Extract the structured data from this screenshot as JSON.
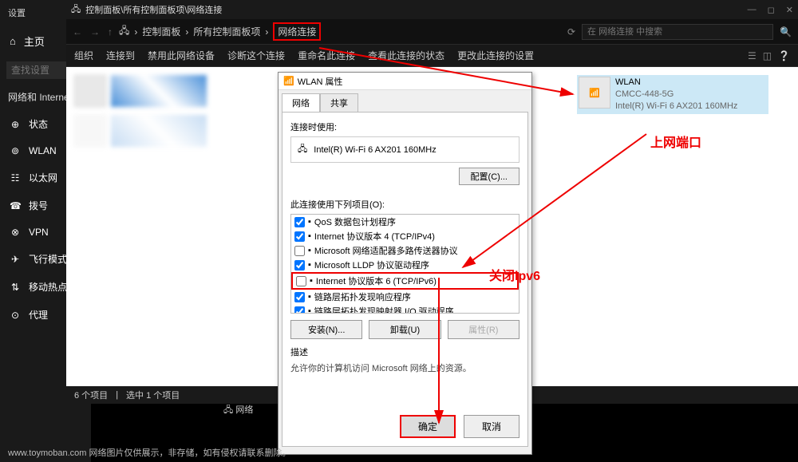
{
  "settings": {
    "title": "设置",
    "home": "主页",
    "search_placeholder": "查找设置",
    "section": "网络和 Internet",
    "items": [
      {
        "icon": "⊕",
        "label": "状态"
      },
      {
        "icon": "⊚",
        "label": "WLAN"
      },
      {
        "icon": "☷",
        "label": "以太网"
      },
      {
        "icon": "☎",
        "label": "拨号"
      },
      {
        "icon": "⊗",
        "label": "VPN"
      },
      {
        "icon": "✈",
        "label": "飞行模式"
      },
      {
        "icon": "⇅",
        "label": "移动热点"
      },
      {
        "icon": "⊙",
        "label": "代理"
      }
    ]
  },
  "cp": {
    "title_path": "控制面板\\所有控制面板项\\网络连接",
    "crumbs": [
      "控制面板",
      "所有控制面板项",
      "网络连接"
    ],
    "search_placeholder": "在 网络连接 中搜索",
    "toolbar": [
      "组织",
      "连接到",
      "禁用此网络设备",
      "诊断这个连接",
      "重命名此连接",
      "查看此连接的状态",
      "更改此连接的设置"
    ],
    "status": {
      "items": "6 个项目",
      "selected": "选中 1 个项目"
    },
    "wlan": {
      "name": "WLAN",
      "ssid": "CMCC-448-5G",
      "adapter": "Intel(R) Wi-Fi 6 AX201 160MHz"
    }
  },
  "dlg": {
    "title": "WLAN 属性",
    "tabs": [
      "网络",
      "共享"
    ],
    "connect_label": "连接时使用:",
    "adapter": "Intel(R) Wi-Fi 6 AX201 160MHz",
    "config_btn": "配置(C)...",
    "items_label": "此连接使用下列项目(O):",
    "items": [
      {
        "checked": true,
        "label": "QoS 数据包计划程序"
      },
      {
        "checked": true,
        "label": "Internet 协议版本 4 (TCP/IPv4)"
      },
      {
        "checked": false,
        "label": "Microsoft 网络适配器多路传送器协议"
      },
      {
        "checked": true,
        "label": "Microsoft LLDP 协议驱动程序"
      },
      {
        "checked": false,
        "label": "Internet 协议版本 6 (TCP/IPv6)",
        "highlight": true
      },
      {
        "checked": true,
        "label": "链路层拓扑发现响应程序"
      },
      {
        "checked": true,
        "label": "链路层拓扑发现映射器 I/O 驱动程序"
      }
    ],
    "install": "安装(N)...",
    "uninstall": "卸载(U)",
    "properties": "属性(R)",
    "desc_label": "描述",
    "desc_text": "允许你的计算机访问 Microsoft 网络上的资源。",
    "ok": "确定",
    "cancel": "取消"
  },
  "anno": {
    "port": "上网端口",
    "ipv6": "关闭ipv6"
  },
  "footer": "www.toymoban.com  网络图片仅供展示，非存储，如有侵权请联系删除。",
  "bottom": "网络"
}
